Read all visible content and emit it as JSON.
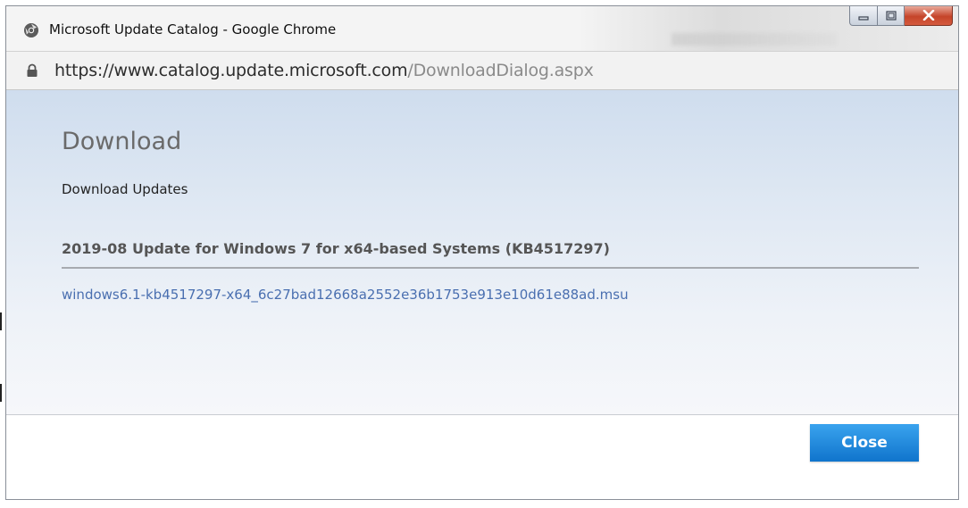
{
  "window": {
    "title": "Microsoft Update Catalog - Google Chrome",
    "controls": [
      "minimize-icon",
      "maximize-icon",
      "close-icon"
    ]
  },
  "address": {
    "host": "https://www.catalog.update.microsoft.com",
    "path": "/DownloadDialog.aspx"
  },
  "dialog": {
    "title": "Download",
    "subtitle": "Download Updates",
    "update_title": "2019-08 Update for Windows 7 for x64-based Systems (KB4517297)",
    "file_name": "windows6.1-kb4517297-x64_6c27bad12668a2552e36b1753e913e10d61e88ad.msu",
    "close_label": "Close"
  },
  "colors": {
    "link": "#4a6fb0",
    "button": "#1a86dd",
    "window_close": "#c5452a"
  }
}
